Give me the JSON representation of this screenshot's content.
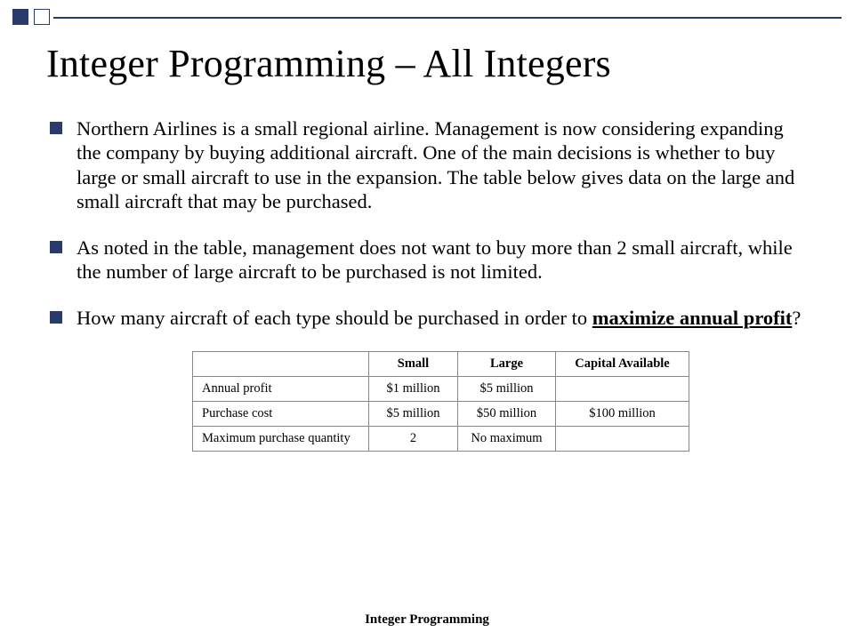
{
  "title": "Integer Programming – All Integers",
  "bullets": {
    "b1": "Northern Airlines is a small regional airline.  Management is now considering expanding the company by buying additional aircraft.  One of the main decisions is whether to buy large or small aircraft to use in the expansion.  The table below gives data on the large and small aircraft that may be purchased.",
    "b2": "As noted in the table, management does not want to buy more than 2 small aircraft, while the number of large aircraft to be purchased is not limited.",
    "b3_pre": "How many aircraft of each type should be purchased in order to ",
    "b3_emph": "maximize annual profit",
    "b3_post": "?"
  },
  "table": {
    "headers": {
      "c1": "Small",
      "c2": "Large",
      "c3": "Capital Available"
    },
    "rows": [
      {
        "label": "Annual profit",
        "c1": "$1 million",
        "c2": "$5  million",
        "c3": ""
      },
      {
        "label": "Purchase cost",
        "c1": "$5 million",
        "c2": "$50 million",
        "c3": "$100 million"
      },
      {
        "label": "Maximum purchase quantity",
        "c1": "2",
        "c2": "No maximum",
        "c3": ""
      }
    ]
  },
  "footer": "Integer Programming"
}
